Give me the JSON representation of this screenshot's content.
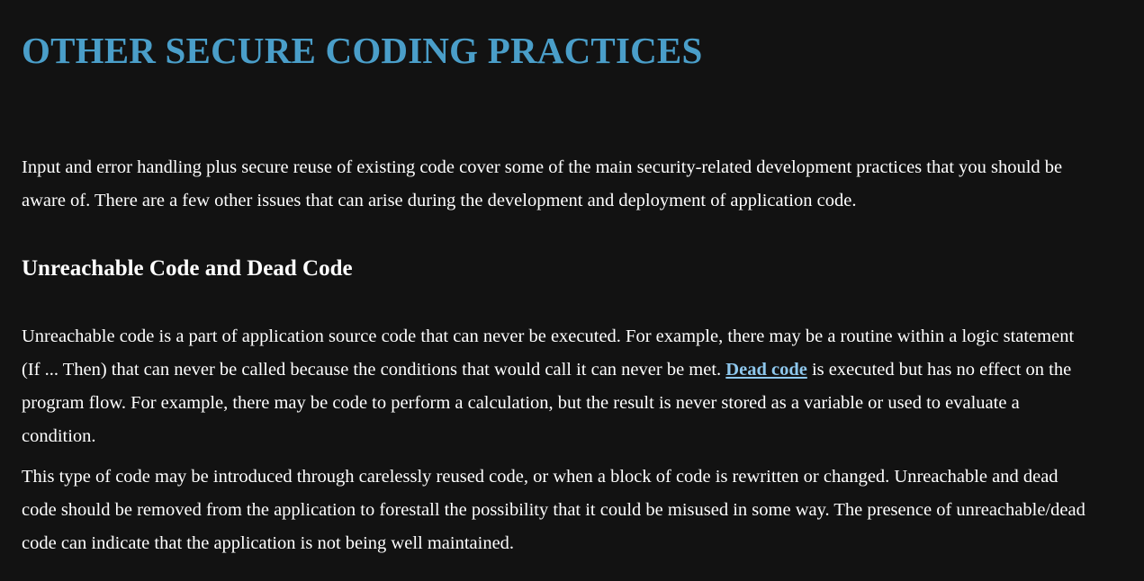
{
  "page": {
    "title": "OTHER SECURE CODING PRACTICES",
    "intro_lines": [
      "Input and error handling plus secure reuse of existing code cover some of the main security-related development practices that you should be",
      "aware of. There are a few other issues that can arise during the development and deployment of application code."
    ]
  },
  "section": {
    "heading": "Unreachable Code and Dead Code",
    "para1": {
      "line1": "Unreachable code is a part of application source code that can never be executed. For example, there may be a routine within a logic statement",
      "line2_before": "(If ... Then) that can never be called because the conditions that would call it can never be met. ",
      "link_text": "Dead code",
      "line2_after": " is executed but has no effect on the",
      "line3": "program flow. For example, there may be code to perform a calculation, but the result is never stored as a variable or used to evaluate a",
      "line4": "condition."
    },
    "para2_lines": [
      "This type of code may be introduced through carelessly reused code, or when a block of code is rewritten or changed. Unreachable and dead",
      "code should be removed from the application to forestall the possibility that it could be misused in some way. The presence of unreachable/dead",
      "code can indicate that the application is not being well maintained."
    ]
  },
  "colors": {
    "background": "#121212",
    "title": "#4a9ec9",
    "text": "#ffffff",
    "link": "#8ec7ec"
  }
}
